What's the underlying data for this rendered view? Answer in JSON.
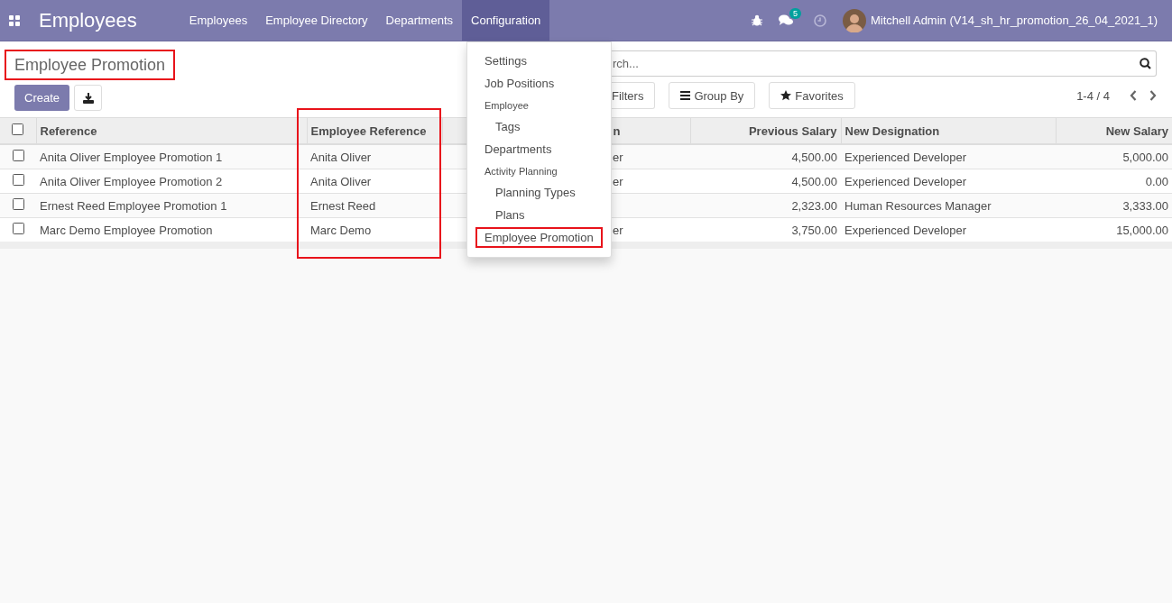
{
  "navbar": {
    "app_title": "Employees",
    "menu": [
      {
        "label": "Employees",
        "selected": false
      },
      {
        "label": "Employee Directory",
        "selected": false
      },
      {
        "label": "Departments",
        "selected": false
      },
      {
        "label": "Configuration",
        "selected": true
      }
    ],
    "message_count": "5",
    "user": "Mitchell Admin (V14_sh_hr_promotion_26_04_2021_1)"
  },
  "control_panel": {
    "title": "Employee Promotion",
    "title_highlighted": true,
    "buttons": [
      "Create"
    ],
    "search": {
      "placeholder": "rch..."
    },
    "filters": [
      {
        "kind": "filter",
        "label": "Filters"
      },
      {
        "kind": "groupby",
        "label": "Group By"
      },
      {
        "kind": "favorites",
        "label": "Favorites"
      }
    ],
    "pager": "1-4 / 4"
  },
  "table": {
    "select_all": false,
    "columns": [
      {
        "label": "Reference",
        "kind": "text",
        "highlighted": false
      },
      {
        "label": "Employee Reference",
        "kind": "text",
        "highlighted": true
      },
      {
        "label": "n",
        "kind": "text",
        "highlighted": false
      },
      {
        "label": "Previous Salary",
        "kind": "number",
        "highlighted": false
      },
      {
        "label": "New Designation",
        "kind": "text",
        "highlighted": false
      },
      {
        "label": "New Salary",
        "kind": "number",
        "highlighted": false
      }
    ],
    "rows": [
      {
        "selected": false,
        "cells": [
          "Anita Oliver Employee Promotion 1",
          "Anita Oliver",
          "er",
          "4,500.00",
          "Experienced Developer",
          "5,000.00"
        ]
      },
      {
        "selected": false,
        "cells": [
          "Anita Oliver Employee Promotion 2",
          "Anita Oliver",
          "er",
          "4,500.00",
          "Experienced Developer",
          "0.00"
        ]
      },
      {
        "selected": false,
        "cells": [
          "Ernest Reed Employee Promotion 1",
          "Ernest Reed",
          null,
          "2,323.00",
          "Human Resources Manager",
          "3,333.00"
        ]
      },
      {
        "selected": false,
        "cells": [
          "Marc Demo Employee Promotion",
          "Marc Demo",
          "er",
          "3,750.00",
          "Experienced Developer",
          "15,000.00"
        ]
      }
    ]
  },
  "dropdown": {
    "items": [
      {
        "kind": "item",
        "label": "Settings",
        "highlighted": false
      },
      {
        "kind": "item",
        "label": "Job Positions",
        "highlighted": false
      },
      {
        "kind": "header",
        "label": "Employee",
        "highlighted": false
      },
      {
        "kind": "subitem",
        "label": "Tags",
        "highlighted": false
      },
      {
        "kind": "item",
        "label": "Departments",
        "highlighted": false
      },
      {
        "kind": "header",
        "label": "Activity Planning",
        "highlighted": false
      },
      {
        "kind": "subitem",
        "label": "Planning Types",
        "highlighted": false
      },
      {
        "kind": "subitem",
        "label": "Plans",
        "highlighted": false
      },
      {
        "kind": "item",
        "label": "Employee Promotion",
        "highlighted": true
      }
    ]
  }
}
